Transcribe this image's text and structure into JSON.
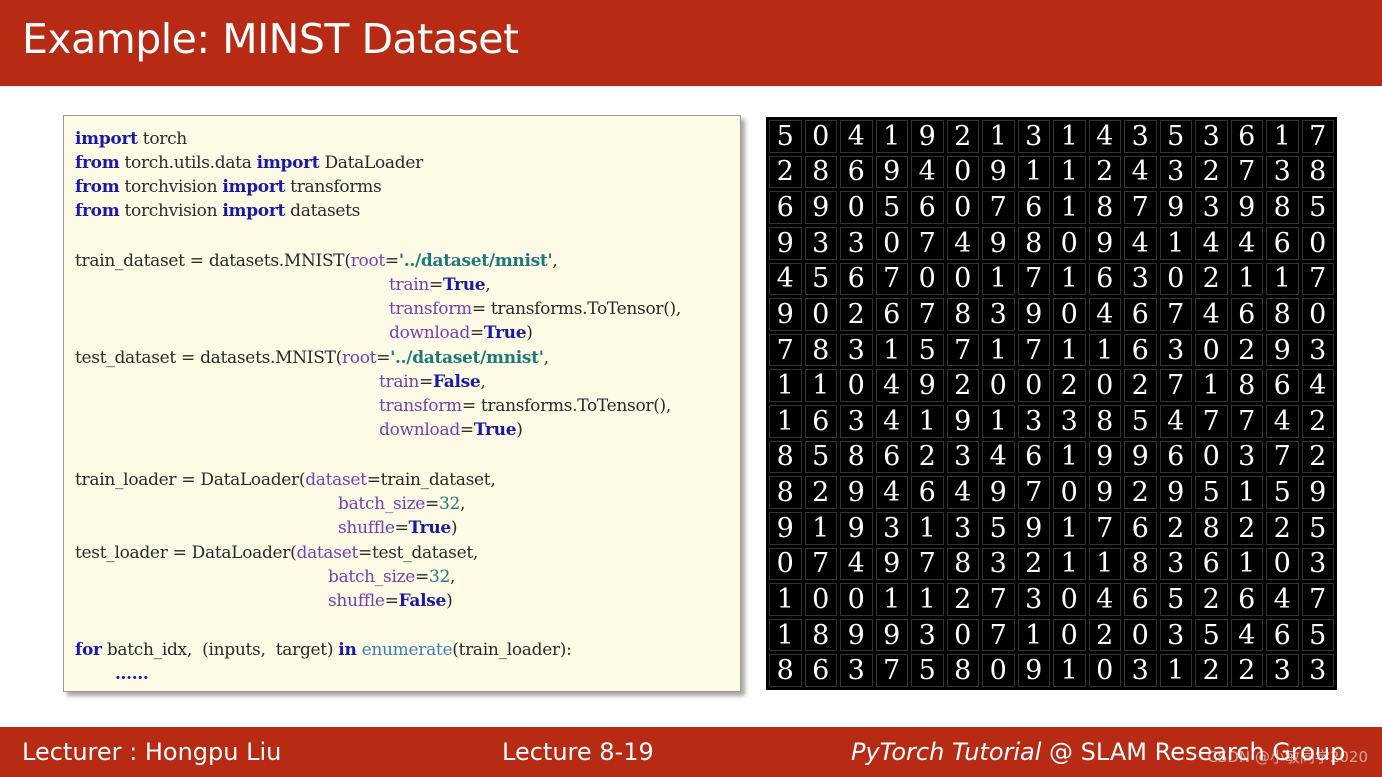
{
  "header": {
    "title": "Example: MINST Dataset"
  },
  "code": {
    "l1_kw": "import",
    "l1_rest": " torch",
    "l2_kw": "from",
    "l2_mid": " torch.utils.data ",
    "l2_kw2": "import",
    "l2_rest": " DataLoader",
    "l3_kw": "from",
    "l3_mid": " torchvision ",
    "l3_kw2": "import",
    "l3_rest": " transforms",
    "l4_kw": "from",
    "l4_mid": " torchvision ",
    "l4_kw2": "import",
    "l4_rest": " datasets",
    "l5_a": "train_dataset = datasets.MNIST(",
    "l5_p": "root",
    "l5_eq": "=",
    "l5_s": "'../dataset/mnist'",
    "l5_c": ",",
    "l6_p": "train",
    "l6_eq": "=",
    "l6_v": "True",
    "l6_c": ",",
    "l7_p": "transform",
    "l7_eq": "= transforms.ToTensor(),",
    "l8_p": "download",
    "l8_eq": "=",
    "l8_v": "True",
    "l8_c": ")",
    "l9_a": "test_dataset = datasets.MNIST(",
    "l9_p": "root",
    "l9_eq": "=",
    "l9_s": "'../dataset/mnist'",
    "l9_c": ",",
    "l10_p": "train",
    "l10_eq": "=",
    "l10_v": "False",
    "l10_c": ",",
    "l11_p": "transform",
    "l11_eq": "= transforms.ToTensor(),",
    "l12_p": "download",
    "l12_eq": "=",
    "l12_v": "True",
    "l12_c": ")",
    "l13_a": "train_loader = DataLoader(",
    "l13_p": "dataset",
    "l13_eq": "=train_dataset,",
    "l14_p": "batch_size",
    "l14_eq": "=",
    "l14_v": "32",
    "l14_c": ",",
    "l15_p": "shuffle",
    "l15_eq": "=",
    "l15_v": "True",
    "l15_c": ")",
    "l16_a": "test_loader = DataLoader(",
    "l16_p": "dataset",
    "l16_eq": "=test_dataset,",
    "l17_p": "batch_size",
    "l17_eq": "=",
    "l17_v": "32",
    "l17_c": ",",
    "l18_p": "shuffle",
    "l18_eq": "=",
    "l18_v": "False",
    "l18_c": ")",
    "l19_kw": "for",
    "l19_mid": " batch_idx,  (inputs,  target) ",
    "l19_kw2": "in",
    "l19_sp": " ",
    "l19_fn": "enumerate",
    "l19_rest": "(train_loader):",
    "l20_dots": "……"
  },
  "digit_rows": [
    "5041921314353617",
    "2869409112432738",
    "6905607618793985",
    "9330749809414460",
    "4567001716302117",
    "9026783904674680",
    "7831571711630293",
    "1104920020271864",
    "1634191338547742",
    "8586234619960372",
    "8294649709295159",
    "9193135917628225",
    "0749783211836103",
    "1001127304652647",
    "1899307102035465",
    "8637580910312233"
  ],
  "footer": {
    "lecturer": "Lecturer : Hongpu Liu",
    "lecture": "Lecture 8-19",
    "tutorial_em": "PyTorch Tutorial",
    "tutorial_rest": " @ SLAM Research Group",
    "watermark": "CSDN @小敏同学2020"
  }
}
